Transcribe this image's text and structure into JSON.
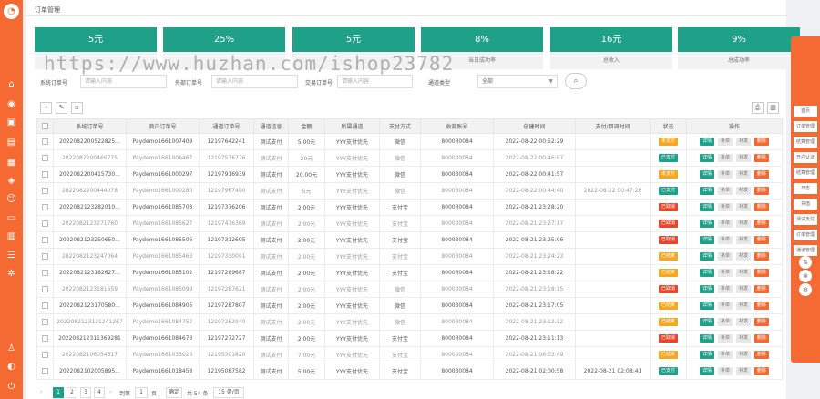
{
  "page_title": "订单管理",
  "stats": [
    {
      "value": "5元",
      "label": ""
    },
    {
      "value": "25%",
      "label": ""
    },
    {
      "value": "5元",
      "label": ""
    },
    {
      "value": "8%",
      "label": "当日成功率"
    },
    {
      "value": "16元",
      "label": "总收入"
    },
    {
      "value": "9%",
      "label": "总成功率"
    }
  ],
  "filters": {
    "merchant_order_label": "系统订单号",
    "merchant_order_placeholder": "请输入内容",
    "external_order_label": "外部订单号",
    "external_order_placeholder": "请输入内容",
    "trade_order_label": "交易订单号",
    "trade_order_placeholder": "请输入内容",
    "channel_type_label": "通道类型",
    "channel_type_value": "全部"
  },
  "columns": [
    "",
    "系统订单号",
    "商户订单号",
    "通道订单号",
    "通道信息",
    "金额",
    "所属通道",
    "支付方式",
    "收款账号",
    "创建时间",
    "支付/回调时间",
    "状态",
    "操作"
  ],
  "rows": [
    {
      "sys": "2022082200522825...",
      "mer": "Paydemo1661007409",
      "ch": "12197642241",
      "info": "测试支付",
      "amt": "5.00元",
      "chan": "YYY支付优先",
      "pay": "微信",
      "acct": "800030084",
      "ctime": "2022-08-22 00:52:29",
      "ptime": "",
      "status": "未支付",
      "status_color": "#f5a623"
    },
    {
      "sys": "2022082200460775",
      "mer": "Paydemo1661006467",
      "ch": "12197576776",
      "info": "测试支付",
      "amt": "20元",
      "chan": "YYY支付优先",
      "pay": "微信",
      "acct": "800030084",
      "ctime": "2022-08-22 00:46:07",
      "ptime": "",
      "status": "已支付",
      "status_color": "#1fa088"
    },
    {
      "sys": "2022082200415730...",
      "mer": "Paydemo1661000297",
      "ch": "12197916939",
      "info": "测试支付",
      "amt": "20.00元",
      "chan": "YYY支付优先",
      "pay": "微信",
      "acct": "800030084",
      "ctime": "2022-08-22 00:41:57",
      "ptime": "",
      "status": "未支付",
      "status_color": "#f5a623"
    },
    {
      "sys": "2022082200444078",
      "mer": "Paydemo1661000280",
      "ch": "12197967490",
      "info": "测试支付",
      "amt": "5元",
      "chan": "YYY支付优先",
      "pay": "微信",
      "acct": "800030084",
      "ctime": "2022-08-22 00:44:40",
      "ptime": "2022-08-22 00:47:28",
      "status": "已支付",
      "status_color": "#1fa088"
    },
    {
      "sys": "2022082123282010...",
      "mer": "Paydemo1661085708",
      "ch": "12197376206",
      "info": "测试支付",
      "amt": "2.00元",
      "chan": "YYY支付优先",
      "pay": "支付宝",
      "acct": "800030084",
      "ctime": "2022-08-21 23:28:20",
      "ptime": "",
      "status": "已取消",
      "status_color": "#e8452c"
    },
    {
      "sys": "2022082123271760",
      "mer": "Paydemo1661085627",
      "ch": "12197476369",
      "info": "测试支付",
      "amt": "2.00元",
      "chan": "YYY支付优先",
      "pay": "支付宝",
      "acct": "800030084",
      "ctime": "2022-08-21 23:27:17",
      "ptime": "",
      "status": "已取消",
      "status_color": "#e8452c"
    },
    {
      "sys": "2022082123250650...",
      "mer": "Paydemo1661085506",
      "ch": "12197312695",
      "info": "测试支付",
      "amt": "2.00元",
      "chan": "YYY支付优先",
      "pay": "支付宝",
      "acct": "800030084",
      "ctime": "2022-08-21 23:25:06",
      "ptime": "",
      "status": "已取消",
      "status_color": "#e8452c"
    },
    {
      "sys": "2022082123247064",
      "mer": "Paydemo1661085463",
      "ch": "12197330091",
      "info": "测试支付",
      "amt": "2.00元",
      "chan": "YYY支付优先",
      "pay": "支付宝",
      "acct": "800030084",
      "ctime": "2022-08-21 23:24:23",
      "ptime": "",
      "status": "已结束",
      "status_color": "#f5a623"
    },
    {
      "sys": "2022082123182627...",
      "mer": "Paydemo1661085102",
      "ch": "12197289687",
      "info": "测试支付",
      "amt": "2.00元",
      "chan": "YYY支付优先",
      "pay": "支付宝",
      "acct": "800030084",
      "ctime": "2022-08-21 23:18:22",
      "ptime": "",
      "status": "已结束",
      "status_color": "#f5a623"
    },
    {
      "sys": "2022082123181659",
      "mer": "Paydemo1661085099",
      "ch": "12197287621",
      "info": "测试支付",
      "amt": "2.00元",
      "chan": "YYY支付优先",
      "pay": "微信",
      "acct": "800030084",
      "ctime": "2022-08-21 23:18:15",
      "ptime": "",
      "status": "已取消",
      "status_color": "#e8452c"
    },
    {
      "sys": "2022082123170580...",
      "mer": "Paydemo1661084905",
      "ch": "12197287807",
      "info": "测试支付",
      "amt": "2.00元",
      "chan": "YYY支付优先",
      "pay": "微信",
      "acct": "800030084",
      "ctime": "2022-08-21 23:17:05",
      "ptime": "",
      "status": "已结束",
      "status_color": "#f5a623"
    },
    {
      "sys": "2022082123121241267",
      "mer": "Paydemo1661084752",
      "ch": "12197262940",
      "info": "测试支付",
      "amt": "2.00元",
      "chan": "YYY支付优先",
      "pay": "微信",
      "acct": "800030084",
      "ctime": "2022-08-21 23:12:12",
      "ptime": "",
      "status": "已结束",
      "status_color": "#f5a623"
    },
    {
      "sys": "202208212311369281",
      "mer": "Paydemo1661084673",
      "ch": "12197272727",
      "info": "测试支付",
      "amt": "2.00元",
      "chan": "YYY支付优先",
      "pay": "支付宝",
      "acct": "800030084",
      "ctime": "2022-08-21 23:11:13",
      "ptime": "",
      "status": "已取消",
      "status_color": "#e8452c"
    },
    {
      "sys": "2022082106034317",
      "mer": "Paydemo1661033023",
      "ch": "12195301820",
      "info": "测试支付",
      "amt": "7.00元",
      "chan": "YYY支付优先",
      "pay": "支付宝",
      "acct": "800030084",
      "ctime": "2022-08-21 06:03:49",
      "ptime": "",
      "status": "已结束",
      "status_color": "#f5a623"
    },
    {
      "sys": "2022082102005895...",
      "mer": "Paydemo1661018458",
      "ch": "12195087582",
      "info": "测试支付",
      "amt": "5.00元",
      "chan": "YYY支付优先",
      "pay": "支付宝",
      "acct": "800030084",
      "ctime": "2022-08-21 02:00:58",
      "ptime": "2022-08-21 02:08:41",
      "status": "已支付",
      "status_color": "#1fa088"
    }
  ],
  "actions": {
    "detail": "详情",
    "resend": "补单",
    "notify": "补发",
    "extra": "删除"
  },
  "pager": {
    "pages": [
      "1",
      "2",
      "3",
      "4"
    ],
    "goto_label": "到第",
    "page_input": "1",
    "page_unit": "页",
    "confirm": "确定",
    "total": "共 54 条",
    "per_page": "15 条/页"
  },
  "right_panel": {
    "buttons": [
      "首页",
      "订单管理",
      "结算管理",
      "开户认证",
      "结算管理",
      "日志",
      "充值",
      "测试支付",
      "订单管理",
      "通道管理"
    ]
  },
  "watermark": "https://www.huzhan.com/ishop23782"
}
